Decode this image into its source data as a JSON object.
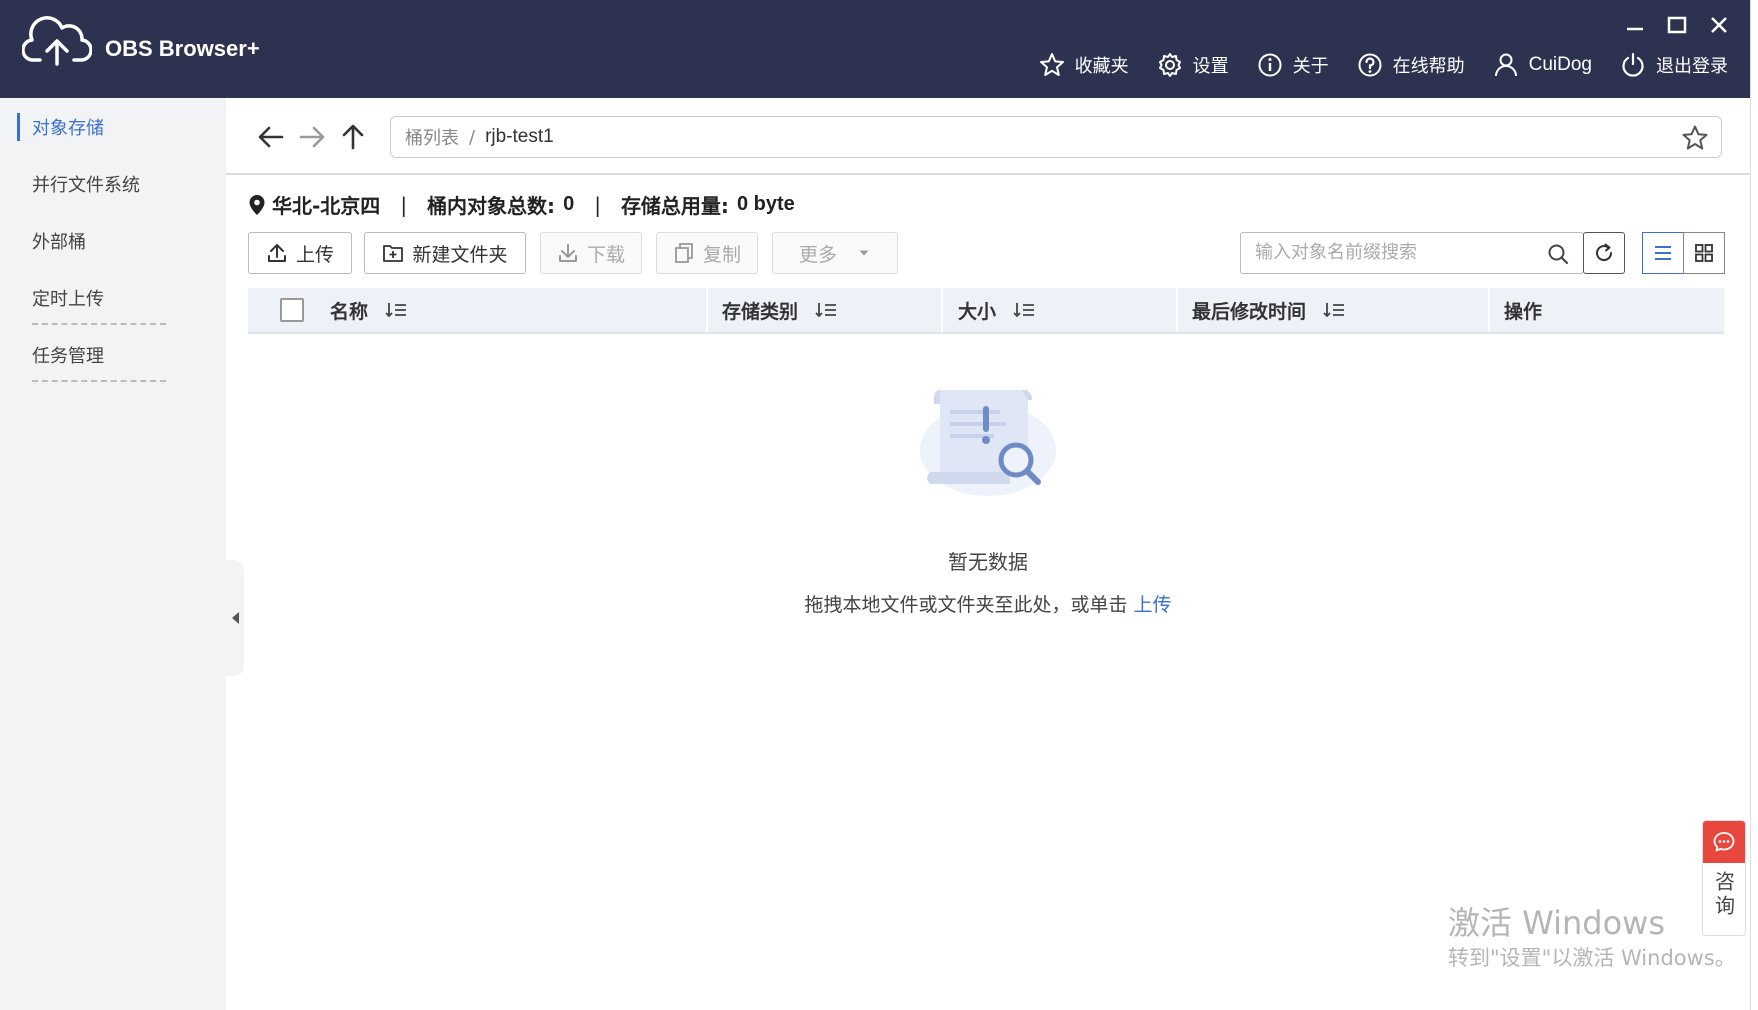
{
  "app": {
    "title": "OBS Browser+"
  },
  "colors": {
    "titlebar": "#2d3250",
    "accent": "#3b6fd1",
    "consult": "#e8473d"
  },
  "topnav": {
    "favorites": "收藏夹",
    "settings": "设置",
    "about": "关于",
    "help": "在线帮助",
    "user": "CuiDog",
    "logout": "退出登录"
  },
  "sidebar": {
    "items": [
      {
        "label": "对象存储"
      },
      {
        "label": "并行文件系统"
      },
      {
        "label": "外部桶"
      },
      {
        "label": "定时上传"
      },
      {
        "label": "任务管理"
      }
    ]
  },
  "breadcrumb": {
    "root": "桶列表",
    "separator": "/",
    "current": "rjb-test1"
  },
  "info": {
    "region": "华北-北京四",
    "object_count_label": "桶内对象总数:",
    "object_count": "0",
    "storage_label": "存储总用量:",
    "storage_value": "0 byte",
    "separator": "|"
  },
  "toolbar": {
    "upload": "上传",
    "new_folder": "新建文件夹",
    "download": "下载",
    "copy": "复制",
    "more": "更多"
  },
  "search": {
    "placeholder": "输入对象名前缀搜索"
  },
  "table": {
    "columns": [
      "名称",
      "存储类别",
      "大小",
      "最后修改时间",
      "操作"
    ]
  },
  "empty": {
    "title": "暂无数据",
    "hint": "拖拽本地文件或文件夹至此处，或单击",
    "link": "上传"
  },
  "consult": {
    "label": "咨询"
  },
  "watermark": {
    "line1": "激活 Windows",
    "line2": "转到\"设置\"以激活 Windows。"
  }
}
